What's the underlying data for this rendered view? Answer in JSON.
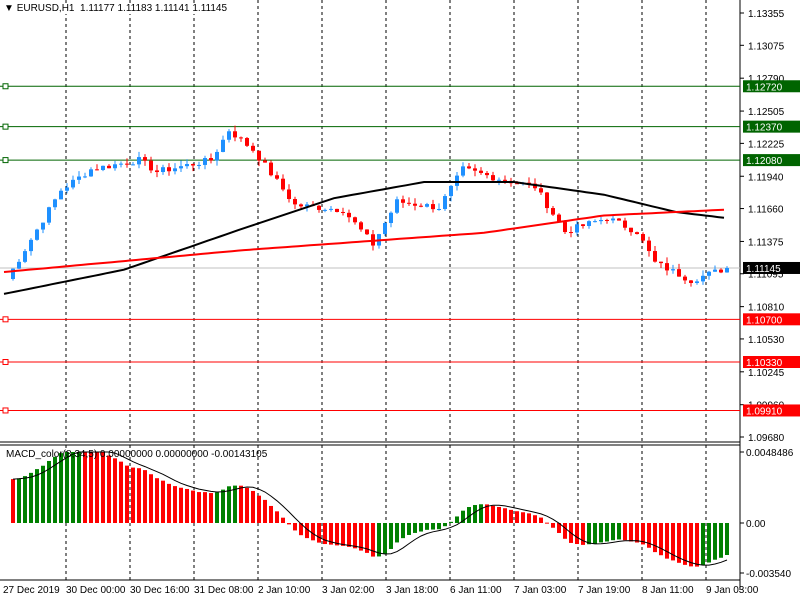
{
  "header": {
    "symbol": "EURUSD,H1",
    "ohlc": "1.11177 1.11183 1.11141 1.11145"
  },
  "macd": {
    "label": "MACD_color(8,34,5) 0.00000000 0.00000000 -0.00143105",
    "ticks": [
      "0.0048486",
      "0.00",
      "-0.003540"
    ]
  },
  "colors": {
    "bull": "#1e90ff",
    "bear": "#ff0000",
    "support": "#ff0000",
    "resistance": "#006400",
    "ma_slow": "#000000",
    "ma_long": "#ff0000",
    "macd_up": "#008000",
    "macd_down": "#ff0000"
  },
  "chart_data": {
    "type": "candlestick",
    "title": "EURUSD,H1",
    "ylim": [
      1.0968,
      1.13355
    ],
    "price_ticks": [
      "1.13355",
      "1.13075",
      "1.12790",
      "1.12505",
      "1.12225",
      "1.11940",
      "1.11660",
      "1.11375",
      "1.11095",
      "1.10810",
      "1.10530",
      "1.10245",
      "1.09960",
      "1.09680"
    ],
    "levels": [
      {
        "price": 1.1272,
        "label": "1.12720",
        "type": "resistance"
      },
      {
        "price": 1.1237,
        "label": "1.12370",
        "type": "resistance"
      },
      {
        "price": 1.1208,
        "label": "1.12080",
        "type": "resistance"
      },
      {
        "price": 1.107,
        "label": "1.10700",
        "type": "support"
      },
      {
        "price": 1.1033,
        "label": "1.10330",
        "type": "support"
      },
      {
        "price": 1.0991,
        "label": "1.09910",
        "type": "support"
      }
    ],
    "current_price": {
      "price": 1.11145,
      "label": "1.11145"
    },
    "x_labels": [
      "27 Dec 2019",
      "30 Dec 00:00",
      "30 Dec 16:00",
      "31 Dec 08:00",
      "2 Jan 10:00",
      "3 Jan 02:00",
      "3 Jan 18:00",
      "6 Jan 11:00",
      "7 Jan 03:00",
      "7 Jan 19:00",
      "8 Jan 11:00",
      "9 Jan 03:00"
    ],
    "close_keypoints": [
      [
        0,
        1.1105
      ],
      [
        9,
        1.1182
      ],
      [
        14,
        1.12
      ],
      [
        22,
        1.1208
      ],
      [
        25,
        1.1198
      ],
      [
        34,
        1.1208
      ],
      [
        37,
        1.1234
      ],
      [
        41,
        1.1217
      ],
      [
        48,
        1.1169
      ],
      [
        56,
        1.1165
      ],
      [
        61,
        1.1135
      ],
      [
        65,
        1.1172
      ],
      [
        72,
        1.1167
      ],
      [
        76,
        1.12
      ],
      [
        82,
        1.1192
      ],
      [
        88,
        1.1185
      ],
      [
        93,
        1.1146
      ],
      [
        100,
        1.1158
      ],
      [
        105,
        1.1146
      ],
      [
        108,
        1.1119
      ],
      [
        114,
        1.1104
      ],
      [
        120,
        1.11145
      ]
    ],
    "ma_slow_keypoints": [
      [
        0,
        1.1092
      ],
      [
        20,
        1.1113
      ],
      [
        40,
        1.1149
      ],
      [
        55,
        1.1175
      ],
      [
        70,
        1.1189
      ],
      [
        85,
        1.1189
      ],
      [
        100,
        1.1178
      ],
      [
        112,
        1.1163
      ],
      [
        120,
        1.1158
      ]
    ],
    "ma_long_keypoints": [
      [
        0,
        1.1111
      ],
      [
        40,
        1.113
      ],
      [
        80,
        1.1145
      ],
      [
        100,
        1.116
      ],
      [
        120,
        1.1165
      ]
    ]
  }
}
